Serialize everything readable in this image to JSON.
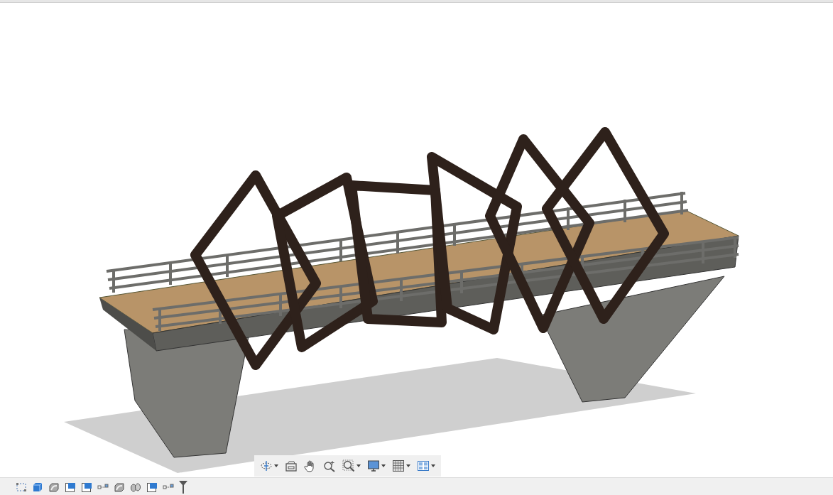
{
  "nav_toolbar": [
    {
      "kind": "orbit",
      "dropdown": true
    },
    {
      "kind": "look-at",
      "dropdown": false
    },
    {
      "kind": "pan",
      "dropdown": false
    },
    {
      "kind": "zoom",
      "dropdown": false
    },
    {
      "kind": "fit",
      "dropdown": true
    },
    {
      "kind": "display",
      "dropdown": true
    },
    {
      "kind": "grid",
      "dropdown": true
    },
    {
      "kind": "viewports",
      "dropdown": true
    }
  ],
  "timeline": [
    {
      "kind": "sketch"
    },
    {
      "kind": "extrude"
    },
    {
      "kind": "shell"
    },
    {
      "kind": "plane"
    },
    {
      "kind": "plane"
    },
    {
      "kind": "joint"
    },
    {
      "kind": "shell"
    },
    {
      "kind": "loft"
    },
    {
      "kind": "plane"
    },
    {
      "kind": "joint"
    }
  ]
}
